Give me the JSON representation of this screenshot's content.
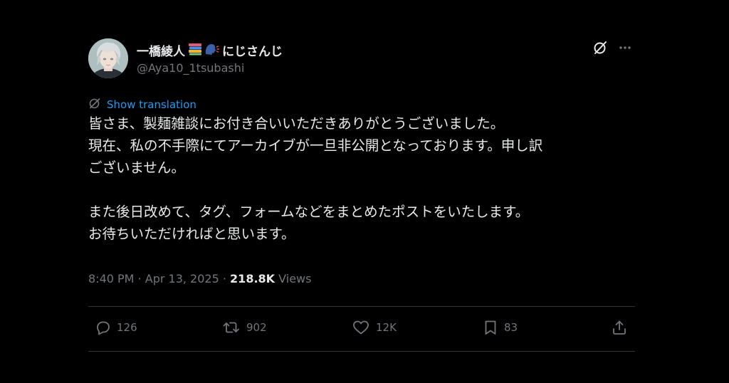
{
  "post": {
    "author": {
      "display_name": "一橋綾人",
      "name_suffix": "にじさんじ",
      "handle": "@Aya10_1tsubashi",
      "emojis": [
        "books-emoji",
        "speaking-head-emoji"
      ]
    },
    "translate_label": "Show translation",
    "body_lines": [
      "皆さま、製麺雑談にお付き合いいただきありがとうございました。",
      "現在、私の不手際にてアーカイブが一旦非公開となっております。申し訳",
      "ございません。",
      "",
      "また後日改めて、タグ、フォームなどをまとめたポストをいたします。",
      "お待ちいただければと思います。"
    ],
    "meta": {
      "time": "8:40 PM",
      "date": "Apr 13, 2025",
      "separator": "·",
      "views_count": "218.8K",
      "views_label": "Views"
    },
    "actions": {
      "replies": "126",
      "reposts": "902",
      "likes": "12K",
      "bookmarks": "83"
    }
  },
  "icons": {
    "grok": "grok-icon",
    "more": "more-icon",
    "translate": "translate-icon",
    "reply": "reply-icon",
    "repost": "repost-icon",
    "like": "heart-icon",
    "bookmark": "bookmark-icon",
    "share": "share-icon"
  },
  "colors": {
    "background": "#000000",
    "text_primary": "#e7e9ea",
    "text_secondary": "#71767b",
    "link": "#1d9bf0",
    "divider": "#2f3336"
  }
}
